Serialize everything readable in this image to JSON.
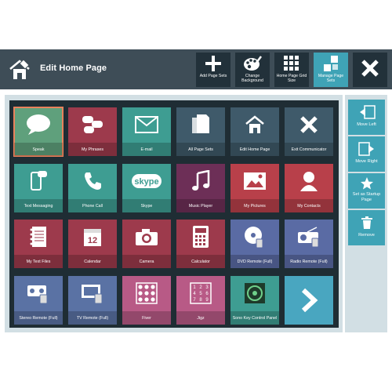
{
  "header": {
    "title": "Edit Home Page",
    "toolbar": [
      {
        "id": "add",
        "label": "Add Page Sets",
        "icon": "plus-icon",
        "active": false
      },
      {
        "id": "bg",
        "label": "Change Background",
        "icon": "palette-icon",
        "active": false
      },
      {
        "id": "size",
        "label": "Home Page Grid Size",
        "icon": "grid-icon",
        "active": false
      },
      {
        "id": "manage",
        "label": "Manage Page Sets",
        "icon": "manage-icon",
        "active": true
      }
    ],
    "close_icon": "close-icon"
  },
  "tiles": [
    {
      "label": "Speak",
      "color": "#5fa07c",
      "icon": "speech-bubble-icon",
      "selected": true
    },
    {
      "label": "My Phrases",
      "color": "#9d3a4c",
      "icon": "phrases-icon"
    },
    {
      "label": "E-mail",
      "color": "#3e9d92",
      "icon": "envelope-icon"
    },
    {
      "label": "All Page Sets",
      "color": "#3f5a6a",
      "icon": "pages-icon"
    },
    {
      "label": "Edit Home Page",
      "color": "#3f5a6a",
      "icon": "home-edit-icon"
    },
    {
      "label": "Exit Communicator",
      "color": "#3f5a6a",
      "icon": "x-icon"
    },
    {
      "label": "Text Messaging",
      "color": "#3e9d92",
      "icon": "phone-message-icon"
    },
    {
      "label": "Phone Call",
      "color": "#3e9d92",
      "icon": "phone-icon"
    },
    {
      "label": "Skype",
      "color": "#3e9d92",
      "icon": "skype-icon"
    },
    {
      "label": "Music Player",
      "color": "#6d2f57",
      "icon": "music-note-icon"
    },
    {
      "label": "My Pictures",
      "color": "#b8404a",
      "icon": "picture-icon"
    },
    {
      "label": "My Contacts",
      "color": "#b8404a",
      "icon": "contact-icon"
    },
    {
      "label": "My Text Files",
      "color": "#9d3a4c",
      "icon": "notebook-icon"
    },
    {
      "label": "Calendar",
      "color": "#9d3a4c",
      "icon": "calendar-icon"
    },
    {
      "label": "Camera",
      "color": "#9d3a4c",
      "icon": "camera-icon"
    },
    {
      "label": "Calculator",
      "color": "#9d3a4c",
      "icon": "calculator-icon"
    },
    {
      "label": "DVD Remote (Full)",
      "color": "#5a6ba4",
      "icon": "dvd-icon"
    },
    {
      "label": "Radio Remote (Full)",
      "color": "#5a6ba4",
      "icon": "radio-icon"
    },
    {
      "label": "Stereo Remote (Full)",
      "color": "#5a72a4",
      "icon": "stereo-icon"
    },
    {
      "label": "TV Remote (Full)",
      "color": "#5a72a4",
      "icon": "tv-icon"
    },
    {
      "label": "Fiver",
      "color": "#b85a86",
      "icon": "fiver-icon"
    },
    {
      "label": "Jigz",
      "color": "#b85a86",
      "icon": "jigz-icon"
    },
    {
      "label": "Sono Key Control Panel",
      "color": "#3e9d92",
      "icon": "sono-icon"
    },
    {
      "label": "",
      "color": "#49a6c0",
      "icon": "chevron-right-icon"
    }
  ],
  "side_actions": [
    {
      "label": "Move Left",
      "icon": "move-left-icon"
    },
    {
      "label": "Move Right",
      "icon": "move-right-icon"
    },
    {
      "label": "Set as Startup Page",
      "icon": "star-icon"
    },
    {
      "label": "Remove",
      "icon": "trash-icon"
    }
  ]
}
